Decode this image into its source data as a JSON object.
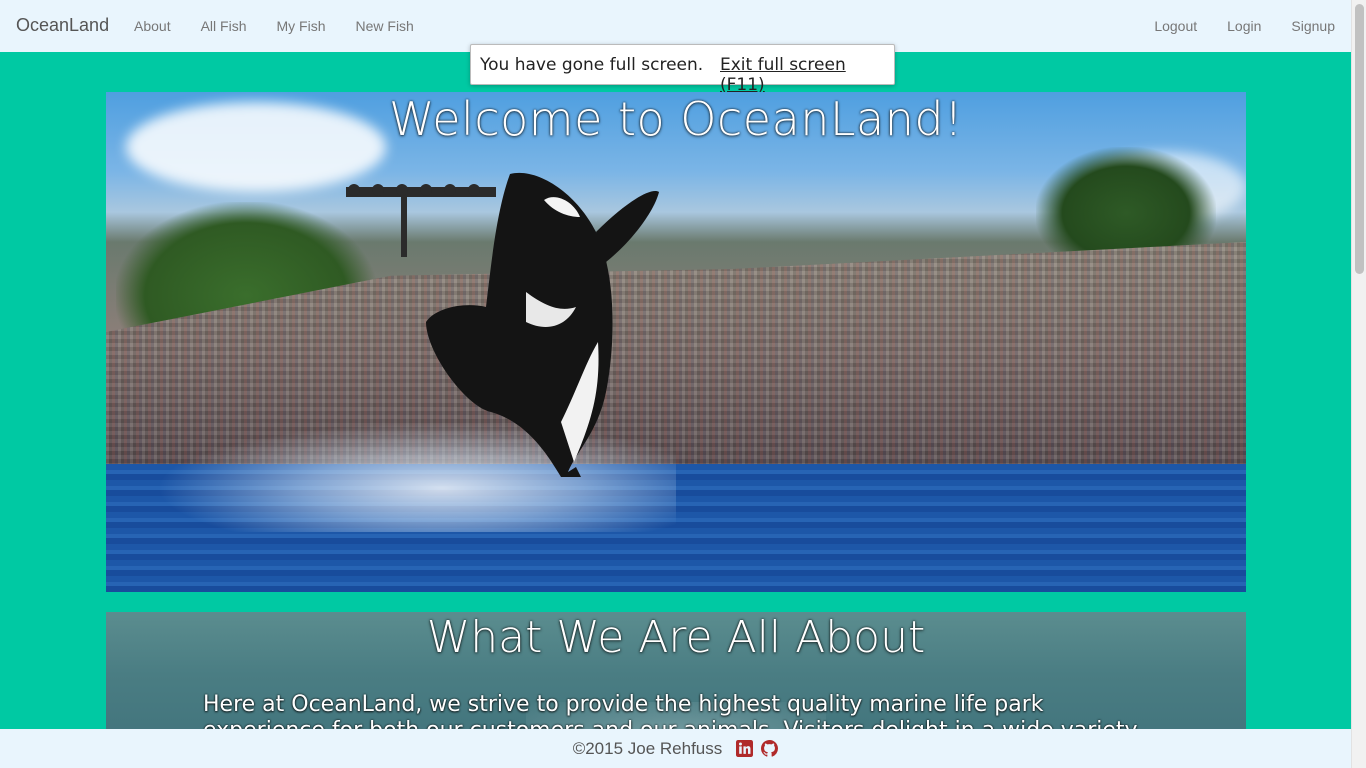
{
  "navbar": {
    "brand": "OceanLand",
    "left_links": [
      "About",
      "All Fish",
      "My Fish",
      "New Fish"
    ],
    "right_links": [
      "Logout",
      "Login",
      "Signup"
    ]
  },
  "fullscreen_popup": {
    "message": "You have gone full screen.",
    "exit_label": "Exit full screen (F11)"
  },
  "hero": {
    "title": "Welcome to OceanLand!"
  },
  "about": {
    "title": "What We Are All About",
    "text": "Here at OceanLand, we strive to provide the highest quality marine life park experience for both our customers and our animals. Visitors delight in a wide variety of exhibits, and our"
  },
  "footer": {
    "copyright": "©2015 Joe Rehfuss",
    "icons": [
      "linkedin-icon",
      "github-icon"
    ]
  },
  "colors": {
    "page_background": "#00c9a3",
    "navbar_background": "#e9f5fd",
    "icon_red": "#b02a2a"
  }
}
